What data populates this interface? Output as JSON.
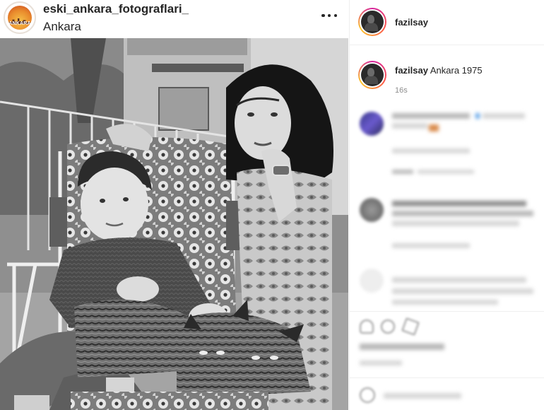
{
  "post": {
    "account_username": "eski_ankara_fotograflari_",
    "location": "Ankara",
    "avatar_logo_text": "ANKARA"
  },
  "panel": {
    "author_username": "fazilsay",
    "caption_username": "fazilsay",
    "caption_text": " Ankara 1975",
    "caption_time": "16s"
  },
  "icons": [
    "more-options-icon",
    "heart-icon",
    "comment-icon",
    "share-icon",
    "emoji-icon"
  ]
}
